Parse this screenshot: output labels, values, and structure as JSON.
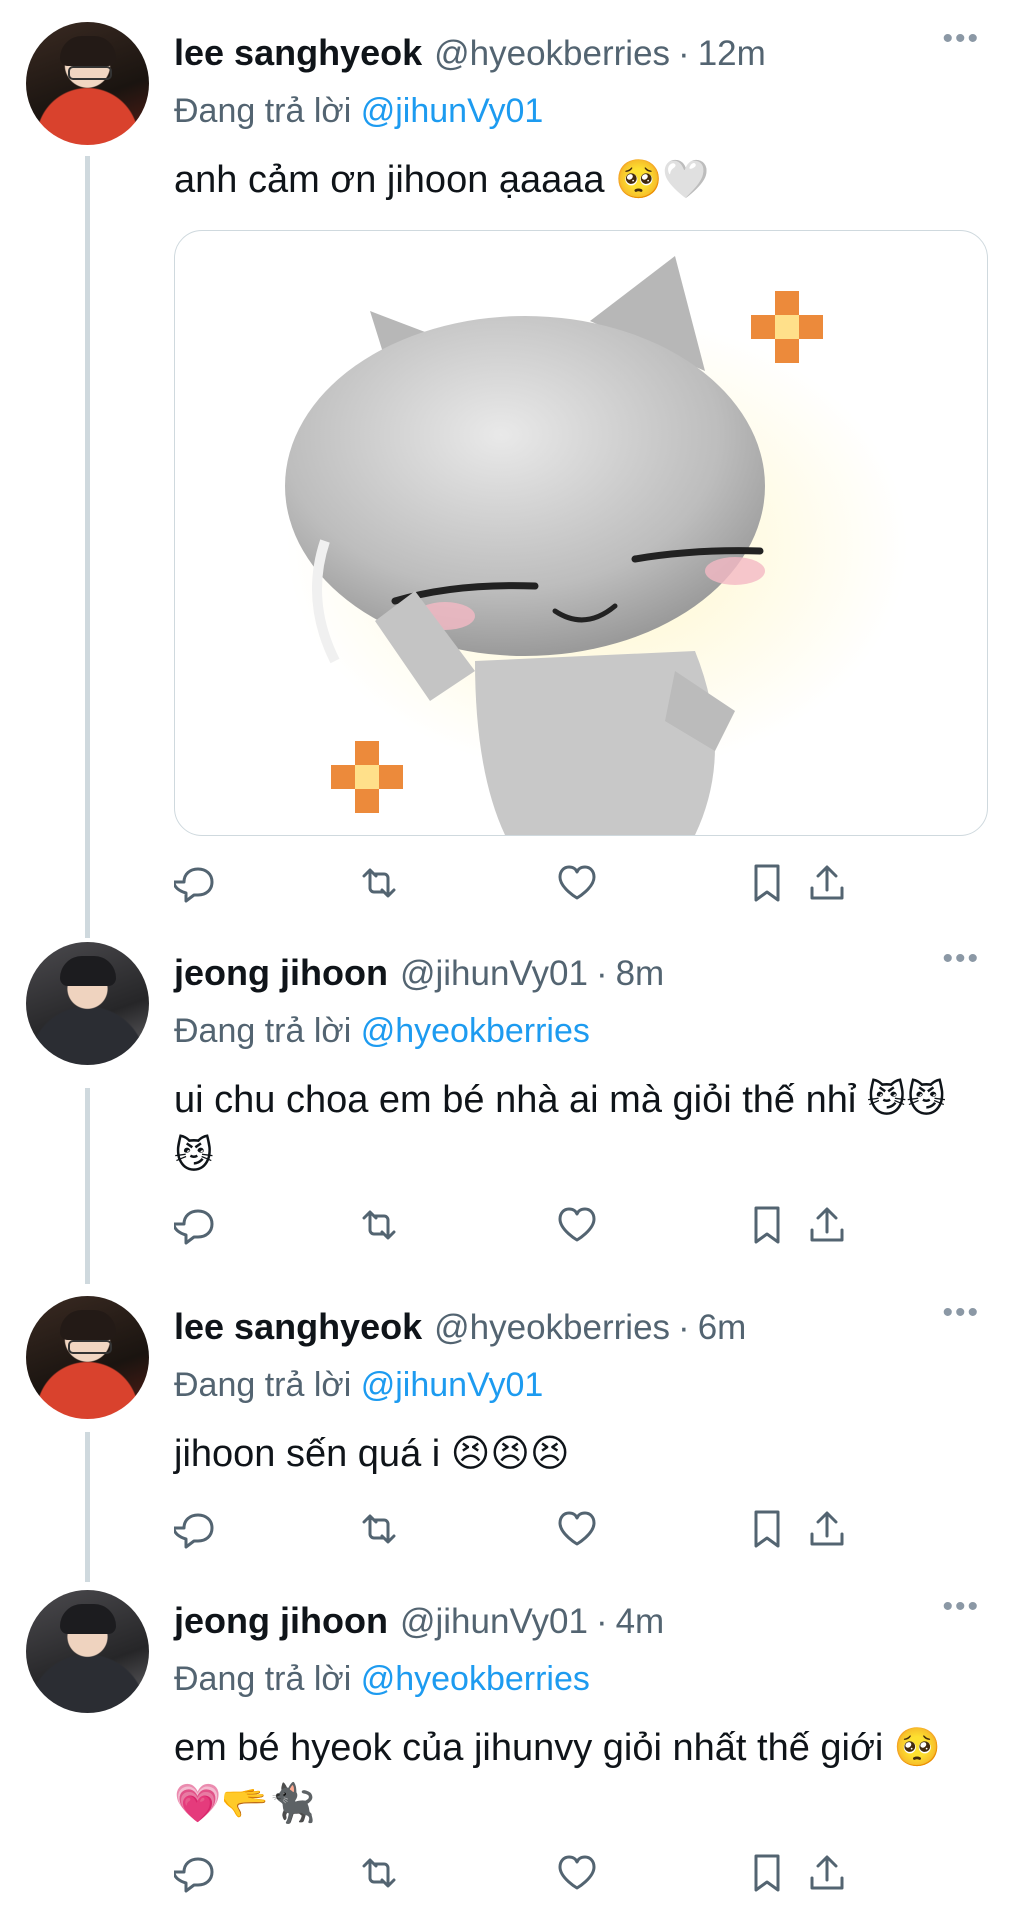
{
  "tweets": [
    {
      "name": "lee sanghyeok",
      "handle": "@hyeokberries",
      "time": "12m",
      "reply_prefix": "Đang trả lời",
      "reply_to": "@jihunVy01",
      "text": "anh cảm ơn jihoon ạaaaa 🥺🤍",
      "has_media": true
    },
    {
      "name": "jeong jihoon",
      "handle": "@jihunVy01",
      "time": "8m",
      "reply_prefix": "Đang trả lời",
      "reply_to": "@hyeokberries",
      "text": "ui chu choa em bé nhà ai mà giỏi thế nhỉ 😼😼😼"
    },
    {
      "name": "lee sanghyeok",
      "handle": "@hyeokberries",
      "time": "6m",
      "reply_prefix": "Đang trả lời",
      "reply_to": "@jihunVy01",
      "text": "jihoon sến quá i 😣😣😣"
    },
    {
      "name": "jeong jihoon",
      "handle": "@jihunVy01",
      "time": "4m",
      "reply_prefix": "Đang trả lời",
      "reply_to": "@hyeokberries",
      "text": "em bé hyeok của jihunvy giỏi nhất thế giới 🥺💗🫳🐈‍⬛"
    }
  ],
  "more_label": "•••",
  "separator": "·",
  "icons": [
    "reply-icon",
    "retweet-icon",
    "like-icon",
    "bookmark-icon",
    "share-icon"
  ],
  "colors": {
    "mention": "#1d9bf0",
    "muted": "#536471",
    "thread_line": "#cfd9de"
  }
}
